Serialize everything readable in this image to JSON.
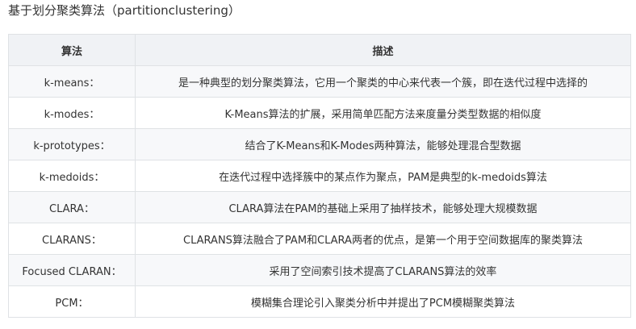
{
  "heading": "基于划分聚类算法（partitionclustering）",
  "table": {
    "headers": [
      "算法",
      "描述"
    ],
    "rows": [
      {
        "algorithm": "k-means：",
        "description": "是一种典型的划分聚类算法，它用一个聚类的中心来代表一个簇，即在迭代过程中选择的"
      },
      {
        "algorithm": "k-modes：",
        "description": "K-Means算法的扩展，采用简单匹配方法来度量分类型数据的相似度"
      },
      {
        "algorithm": "k-prototypes：",
        "description": "结合了K-Means和K-Modes两种算法，能够处理混合型数据"
      },
      {
        "algorithm": "k-medoids：",
        "description": "在迭代过程中选择簇中的某点作为聚点，PAM是典型的k-medoids算法"
      },
      {
        "algorithm": "CLARA：",
        "description": "CLARA算法在PAM的基础上采用了抽样技术，能够处理大规模数据"
      },
      {
        "algorithm": "CLARANS：",
        "description": "CLARANS算法融合了PAM和CLARA两者的优点，是第一个用于空间数据库的聚类算法"
      },
      {
        "algorithm": "Focused CLARAN：",
        "description": "采用了空间索引技术提高了CLARANS算法的效率"
      },
      {
        "algorithm": "PCM：",
        "description": "模糊集合理论引入聚类分析中并提出了PCM模糊聚类算法"
      }
    ]
  }
}
